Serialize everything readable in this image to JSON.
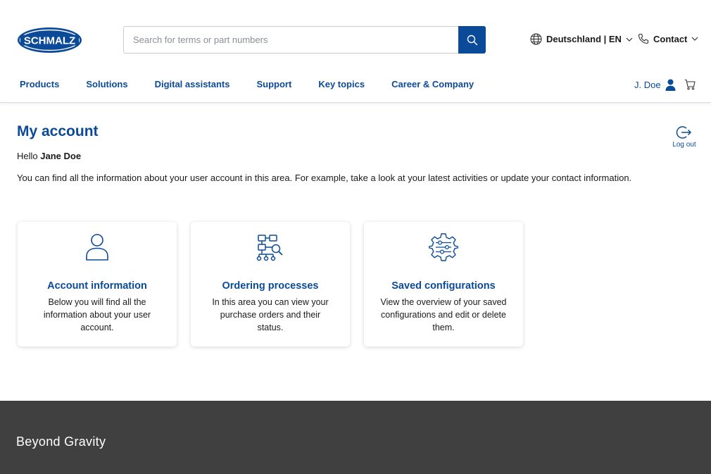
{
  "header": {
    "logo_text": "SCHMALZ",
    "search": {
      "placeholder": "Search for terms or part numbers",
      "value": ""
    },
    "locale_label": "Deutschland | EN",
    "contact_label": "Contact",
    "nav": [
      "Products",
      "Solutions",
      "Digital assistants",
      "Support",
      "Key topics",
      "Career & Company"
    ],
    "user_label": "J. Doe"
  },
  "main": {
    "title": "My account",
    "greeting_prefix": "Hello",
    "user_name": "Jane Doe",
    "intro": "You can find all the information about your user account in this area. For example, take a look at your latest activities or update your contact information.",
    "logout_label": "Log out",
    "cards": [
      {
        "icon": "user-icon",
        "title": "Account information",
        "text": "Below you will find all the information about your user account."
      },
      {
        "icon": "process-flow-icon",
        "title": "Ordering processes",
        "text": "In this area you can view your purchase orders and their status."
      },
      {
        "icon": "gear-settings-icon",
        "title": "Saved configurations",
        "text": "View the overview of your saved configurations and edit or delete them."
      }
    ]
  },
  "footer": {
    "tagline": "Beyond Gravity"
  },
  "colors": {
    "brand_blue": "#0b4a99",
    "footer_bg": "#404040"
  }
}
